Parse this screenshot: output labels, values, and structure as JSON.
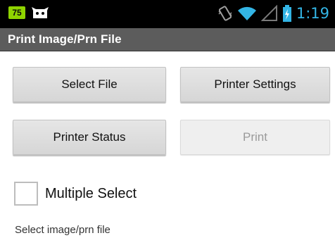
{
  "status_bar": {
    "badge_text": "75",
    "time": "1:19",
    "icons": [
      "cat-notification-icon",
      "vibrate-icon",
      "wifi-icon",
      "signal-icon",
      "battery-charging-icon"
    ],
    "accent_color": "#33b5e5"
  },
  "app": {
    "title": "Print Image/Prn File"
  },
  "buttons": {
    "select_file": "Select File",
    "printer_settings": "Printer Settings",
    "printer_status": "Printer Status",
    "print": "Print"
  },
  "checkbox": {
    "label": "Multiple Select",
    "checked": false
  },
  "hint": "Select image/prn file"
}
